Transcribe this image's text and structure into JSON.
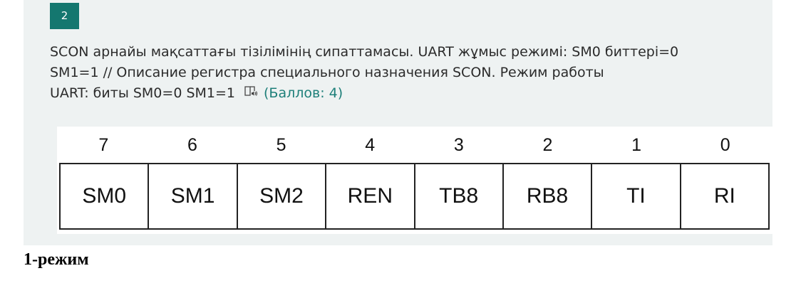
{
  "question": {
    "number": "2",
    "text_lines": [
      "SCON арнайы мақсаттағы тізілімінің сипаттамасы. UART жұмыс режимі: SM0 биттері=0",
      "SM1=1 // Описание регистра специального назначения SCON. Режим работы",
      "UART: биты SM0=0 SM1=1"
    ],
    "reader_icon": "immersive-reader-icon",
    "points": "(Баллов: 4)"
  },
  "register": {
    "bit_numbers": [
      "7",
      "6",
      "5",
      "4",
      "3",
      "2",
      "1",
      "0"
    ],
    "bit_names": [
      "SM0",
      "SM1",
      "SM2",
      "REN",
      "TB8",
      "RB8",
      "TI",
      "RI"
    ]
  },
  "footer": {
    "mode_label": "1-режим"
  },
  "colors": {
    "accent": "#14776f",
    "points": "#1d7f79",
    "card_background": "#eef2f2"
  }
}
